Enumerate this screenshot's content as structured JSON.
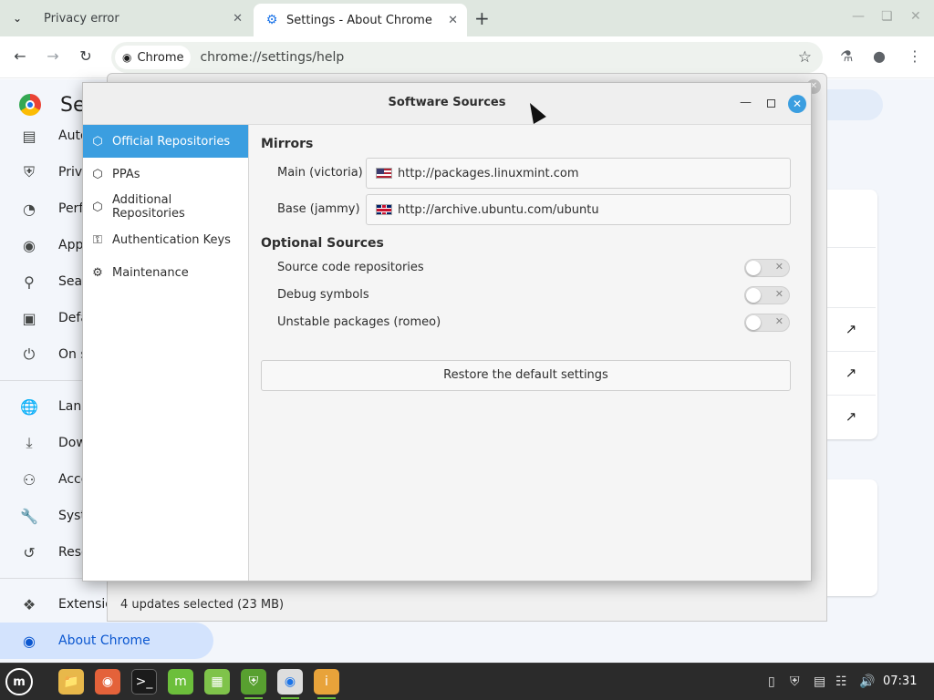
{
  "browser": {
    "tabs": [
      {
        "label": "Privacy error",
        "active": false
      },
      {
        "label": "Settings - About Chrome",
        "active": true
      }
    ],
    "security_chip": "Chrome",
    "url": "chrome://settings/help"
  },
  "settings": {
    "title": "Se",
    "sidebar": [
      {
        "label": "Auto",
        "icon": "autofill-icon"
      },
      {
        "label": "Priva",
        "icon": "shield-icon"
      },
      {
        "label": "Perf",
        "icon": "speedometer-icon"
      },
      {
        "label": "Appe",
        "icon": "palette-icon"
      },
      {
        "label": "Sear",
        "icon": "search-icon"
      },
      {
        "label": "Defa",
        "icon": "browser-icon"
      },
      {
        "label": "On s",
        "icon": "power-icon"
      },
      {
        "label": "Lang",
        "icon": "globe-icon"
      },
      {
        "label": "Dow",
        "icon": "download-icon"
      },
      {
        "label": "Acce",
        "icon": "accessibility-icon"
      },
      {
        "label": "Syst",
        "icon": "wrench-icon"
      },
      {
        "label": "Rese",
        "icon": "reset-icon"
      },
      {
        "label": "Extensio",
        "icon": "puzzle-icon"
      },
      {
        "label": "About Chrome",
        "icon": "chrome-icon"
      }
    ]
  },
  "update_manager": {
    "status": "4 updates selected (23 MB)"
  },
  "dialog": {
    "title": "Software Sources",
    "sidebar": [
      {
        "label": "Official Repositories",
        "icon": "package-icon",
        "active": true
      },
      {
        "label": "PPAs",
        "icon": "package-icon",
        "active": false
      },
      {
        "label": "Additional Repositories",
        "icon": "package-icon",
        "active": false
      },
      {
        "label": "Authentication Keys",
        "icon": "key-icon",
        "active": false
      },
      {
        "label": "Maintenance",
        "icon": "gear-icon",
        "active": false
      }
    ],
    "mirrors": {
      "heading": "Mirrors",
      "main_label": "Main (victoria)",
      "main_url": "http://packages.linuxmint.com",
      "base_label": "Base (jammy)",
      "base_url": "http://archive.ubuntu.com/ubuntu"
    },
    "optional": {
      "heading": "Optional Sources",
      "items": [
        {
          "label": "Source code repositories",
          "enabled": false
        },
        {
          "label": "Debug symbols",
          "enabled": false
        },
        {
          "label": "Unstable packages (romeo)",
          "enabled": false
        }
      ]
    },
    "restore_button": "Restore the default settings",
    "accent_color": "#3b9ee0"
  },
  "taskbar": {
    "clock": "07:31"
  }
}
